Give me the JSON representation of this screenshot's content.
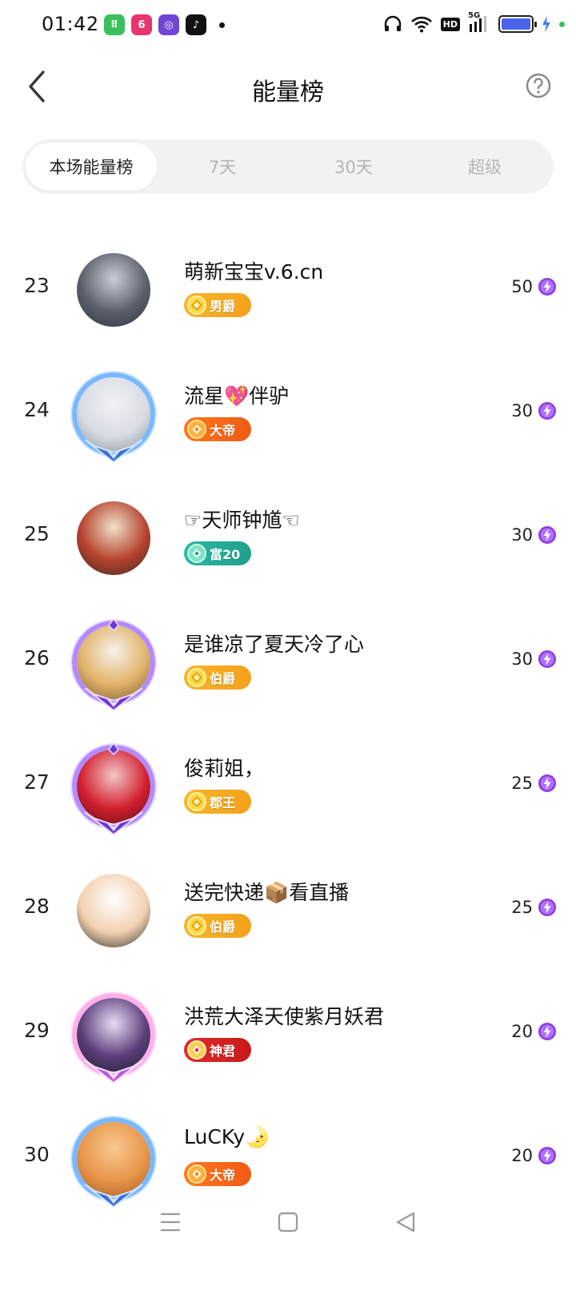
{
  "status": {
    "time": "01:42",
    "network": "5G",
    "hd": "HD",
    "apps": [
      {
        "icon": "green-app-icon",
        "color": "#3ac05a",
        "glyph": "⠿"
      },
      {
        "icon": "six-room-app-icon",
        "color": "#e8356f",
        "glyph": "6"
      },
      {
        "icon": "purple-ring-app-icon",
        "color": "#7046d6",
        "glyph": "◎"
      },
      {
        "icon": "tiktok-icon",
        "color": "#111111",
        "glyph": "♪"
      }
    ]
  },
  "header": {
    "title": "能量榜"
  },
  "tabs": [
    {
      "label": "本场能量榜",
      "active": true
    },
    {
      "label": "7天",
      "active": false
    },
    {
      "label": "30天",
      "active": false
    },
    {
      "label": "超级",
      "active": false
    }
  ],
  "rows": [
    {
      "rank": "23",
      "name": "萌新宝宝v.6.cn",
      "badge": "男爵",
      "badge_style": "gold",
      "score": "50",
      "frame": "none",
      "avatar_colors": [
        "#c9ced6",
        "#5a5f6b",
        "#2f3440"
      ]
    },
    {
      "rank": "24",
      "name": "流星💖伴驴",
      "badge": "大帝",
      "badge_style": "orange",
      "score": "30",
      "frame": "blue",
      "avatar_colors": [
        "#f0f2f5",
        "#d9dde3",
        "#8a8f99"
      ]
    },
    {
      "rank": "25",
      "name": "☞天师钟馗☜",
      "badge": "富20",
      "badge_style": "teal",
      "score": "30",
      "frame": "none",
      "avatar_colors": [
        "#efe2c8",
        "#b7422e",
        "#3a2a22"
      ]
    },
    {
      "rank": "26",
      "name": "是谁凉了夏天冷了心",
      "badge": "伯爵",
      "badge_style": "gold",
      "score": "30",
      "frame": "purple",
      "avatar_colors": [
        "#f6f2ea",
        "#e2b36a",
        "#7a5a2f"
      ]
    },
    {
      "rank": "27",
      "name": "俊莉姐，",
      "badge": "郡王",
      "badge_style": "gold",
      "score": "25",
      "frame": "purple",
      "avatar_colors": [
        "#f4c6c9",
        "#d2202f",
        "#5a0d15"
      ]
    },
    {
      "rank": "28",
      "name": "送完快递📦看直播",
      "badge": "伯爵",
      "badge_style": "gold",
      "score": "25",
      "frame": "none",
      "avatar_colors": [
        "#ffffff",
        "#f2d1b0",
        "#2b2b2b"
      ]
    },
    {
      "rank": "29",
      "name": "洪荒大泽天使紫月妖君",
      "badge": "神君",
      "badge_style": "red",
      "score": "20",
      "frame": "pink",
      "avatar_colors": [
        "#e9dcf5",
        "#5a3d7a",
        "#1f1f2e"
      ]
    },
    {
      "rank": "30",
      "name": "LuCKy🌛",
      "badge": "大帝",
      "badge_style": "orange",
      "score": "20",
      "frame": "blue",
      "avatar_colors": [
        "#f7c98e",
        "#e8964a",
        "#a85a22"
      ]
    }
  ],
  "colors": {
    "energy": "#8d3be0",
    "accent": "#111111"
  }
}
